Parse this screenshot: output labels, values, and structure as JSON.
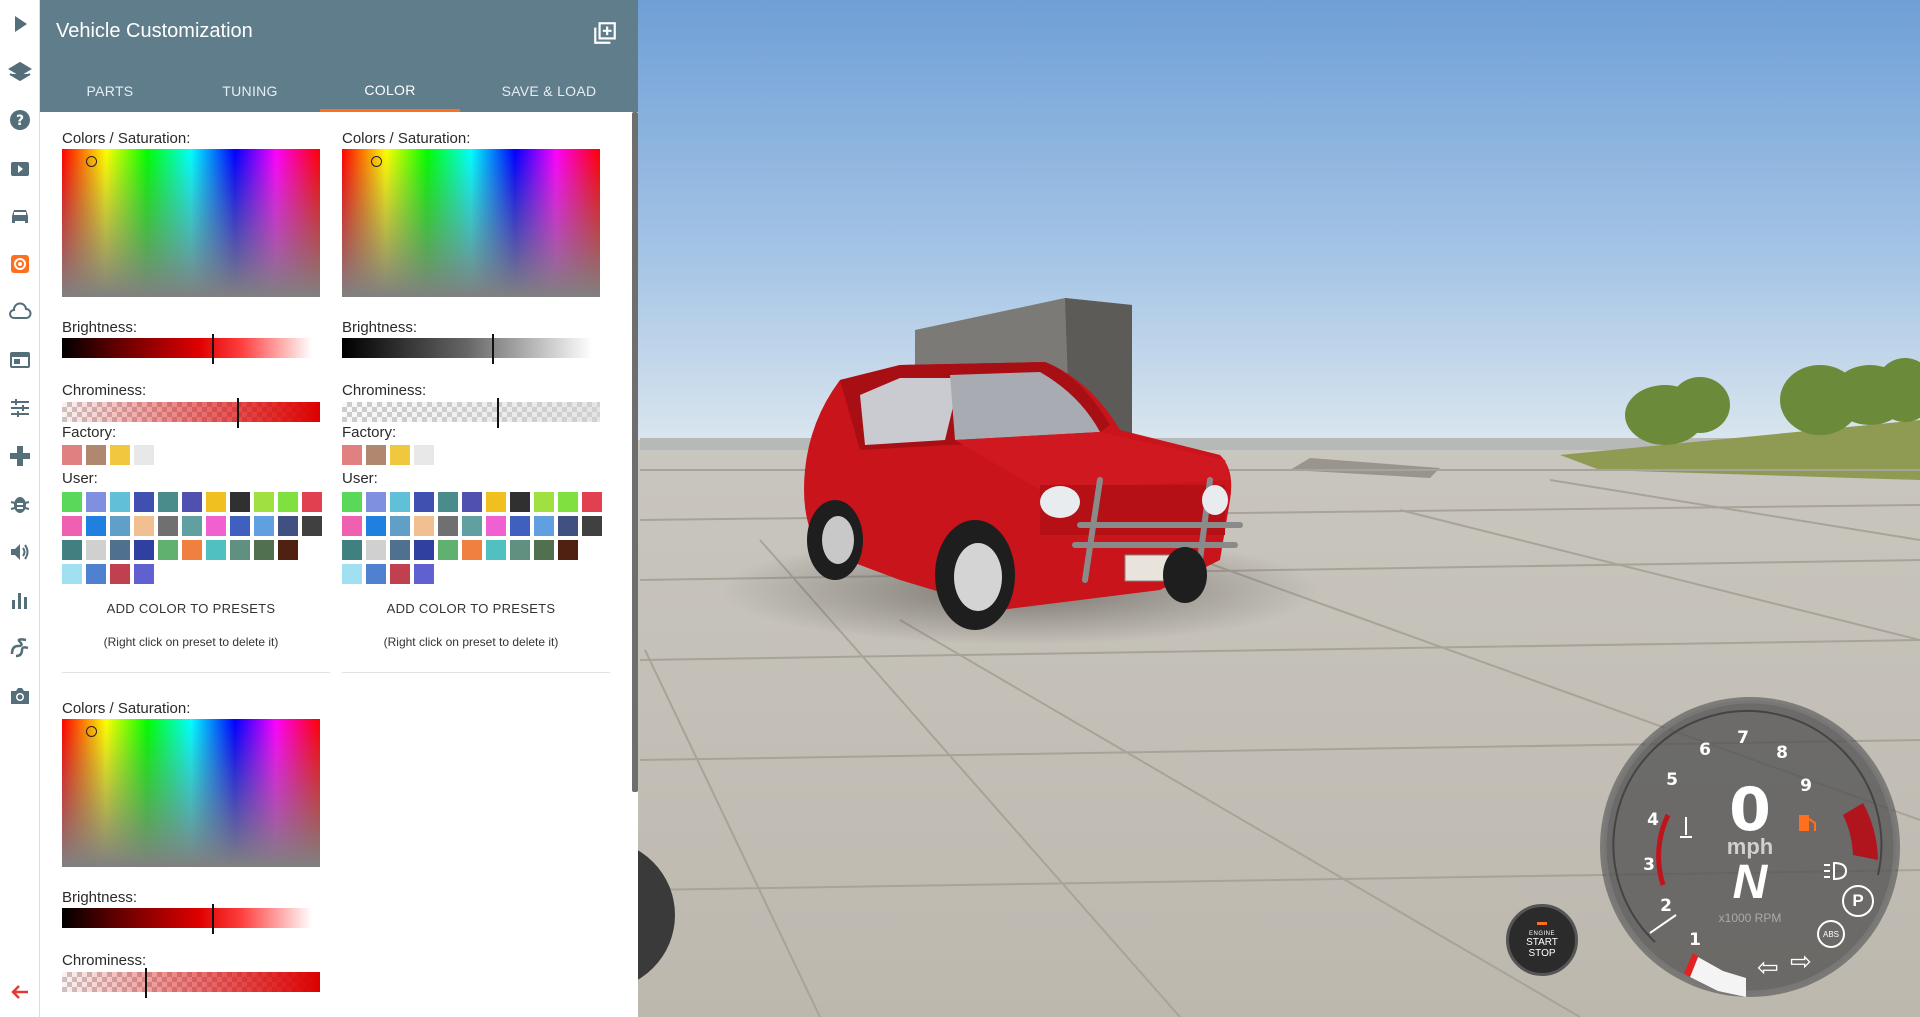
{
  "panel": {
    "title": "Vehicle Customization",
    "tabs": [
      {
        "label": "PARTS"
      },
      {
        "label": "TUNING"
      },
      {
        "label": "COLOR"
      },
      {
        "label": "SAVE & LOAD"
      }
    ],
    "active_tab": "COLOR"
  },
  "color_pickers": [
    {
      "sat_label": "Colors / Saturation:",
      "brightness_label": "Brightness:",
      "chrominess_label": "Chrominess:",
      "factory_label": "Factory:",
      "user_label": "User:",
      "brightness": 0.6,
      "chrominess": 0.68,
      "add_label": "ADD COLOR TO PRESETS",
      "hint": "(Right click on preset to delete it)"
    },
    {
      "sat_label": "Colors / Saturation:",
      "brightness_label": "Brightness:",
      "chrominess_label": "Chrominess:",
      "factory_label": "Factory:",
      "user_label": "User:",
      "brightness": 0.6,
      "chrominess": 0.6,
      "add_label": "ADD COLOR TO PRESETS",
      "hint": "(Right click on preset to delete it)"
    },
    {
      "sat_label": "Colors / Saturation:",
      "brightness_label": "Brightness:",
      "chrominess_label": "Chrominess:",
      "brightness": 0.6,
      "chrominess": 0.32
    }
  ],
  "factory_colors": [
    "#e08080",
    "#b08870",
    "#f0c840",
    "#e8e8e8"
  ],
  "user_colors": [
    [
      "#5ad85a",
      "#8090e0",
      "#60c0d8",
      "#4050b0",
      "#4a8c8c",
      "#5050b0",
      "#f0c020",
      "#303030",
      "#a0e040",
      "#80e040",
      "#e04050"
    ],
    [
      "#f060b0",
      "#2080e0",
      "#60a0c8",
      "#f0c090",
      "#707070",
      "#60a0a0",
      "#f060d0",
      "#4060c0",
      "#60a0e0",
      "#405080",
      "#404040"
    ],
    [
      "#408080",
      "#d0d0d0",
      "#507090",
      "#3040a0",
      "#60b070",
      "#f08040",
      "#50c0c0",
      "#609080",
      "#507050",
      "#502010"
    ],
    [
      "#a0e0f0",
      "#5080d0",
      "#c04050",
      "#6060d0"
    ]
  ],
  "hud": {
    "speed": "0",
    "unit": "mph",
    "gear": "N",
    "rpm_label": "x1000 RPM",
    "rpm_ticks": [
      "1",
      "2",
      "3",
      "4",
      "5",
      "6",
      "7",
      "8",
      "9"
    ],
    "engine_small": "ENGINE",
    "engine_start": "START",
    "engine_stop": "STOP",
    "abs_label": "ABS",
    "park_label": "P"
  },
  "icons": [
    "play-icon",
    "layers-icon",
    "help-icon",
    "video-icon",
    "car-icon",
    "settings-icon",
    "cloud-icon",
    "dashboard-icon",
    "sliders-icon",
    "gamepad-icon",
    "bug-icon",
    "volume-icon",
    "stats-icon",
    "route-icon",
    "camera-icon",
    "back-arrow-icon"
  ],
  "colors": {
    "header": "#607d8b",
    "accent": "#ff6f1e",
    "car_red": "#c8141a"
  }
}
